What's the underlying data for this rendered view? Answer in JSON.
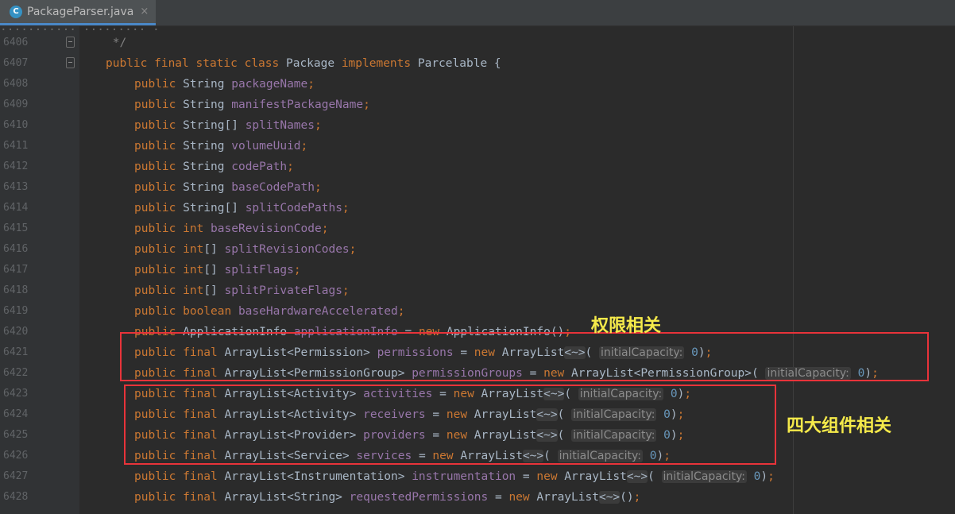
{
  "tab": {
    "icon_letter": "C",
    "filename": "PackageParser.java",
    "close": "×"
  },
  "top_fragment": "    ...........              .........                .",
  "lines": [
    {
      "num": "6406",
      "comment": " */"
    },
    {
      "num": "6407",
      "kw": "public final static class",
      "type": " Package ",
      "kw2": "implements",
      "type2": " Parcelable {"
    },
    {
      "num": "6408",
      "kw": "public",
      "type": " String ",
      "field": "packageName",
      "punct": ";"
    },
    {
      "num": "6409",
      "kw": "public",
      "type": " String ",
      "field": "manifestPackageName",
      "punct": ";"
    },
    {
      "num": "6410",
      "kw": "public",
      "type": " String[] ",
      "field": "splitNames",
      "punct": ";"
    },
    {
      "num": "6411",
      "kw": "public",
      "type": " String ",
      "field": "volumeUuid",
      "punct": ";"
    },
    {
      "num": "6412",
      "kw": "public",
      "type": " String ",
      "field": "codePath",
      "punct": ";"
    },
    {
      "num": "6413",
      "kw": "public",
      "type": " String ",
      "field": "baseCodePath",
      "punct": ";"
    },
    {
      "num": "6414",
      "kw": "public",
      "type": " String[] ",
      "field": "splitCodePaths",
      "punct": ";"
    },
    {
      "num": "6415",
      "kw": "public int",
      "type": " ",
      "field": "baseRevisionCode",
      "punct": ";"
    },
    {
      "num": "6416",
      "kw": "public int",
      "type": "[] ",
      "field": "splitRevisionCodes",
      "punct": ";"
    },
    {
      "num": "6417",
      "kw": "public int",
      "type": "[] ",
      "field": "splitFlags",
      "punct": ";"
    },
    {
      "num": "6418",
      "kw": "public int",
      "type": "[] ",
      "field": "splitPrivateFlags",
      "punct": ";"
    },
    {
      "num": "6419",
      "kw": "public boolean",
      "type": " ",
      "field": "baseHardwareAccelerated",
      "punct": ";"
    },
    {
      "num": "6420",
      "kw": "public",
      "type": " ApplicationInfo ",
      "field": "applicationInfo",
      "eq": " = ",
      "kw2": "new",
      "rest": " ApplicationInfo()",
      "punct": ";"
    },
    {
      "num": "6421",
      "kw": "public final",
      "type": " ArrayList<Permission> ",
      "field": "permissions",
      "eq": " = ",
      "kw2": "new",
      "rest": " ArrayList",
      "diamond": "<~>",
      "open": "( ",
      "hint": "initialCapacity:",
      "num_val": " 0",
      "close": ")",
      "punct": ";"
    },
    {
      "num": "6422",
      "kw": "public final",
      "type": " ArrayList<PermissionGroup> ",
      "field": "permissionGroups",
      "eq": " = ",
      "kw2": "new",
      "rest": " ArrayList<PermissionGroup>",
      "open": "( ",
      "hint": "initialCapacity:",
      "num_val": " 0",
      "close": ")",
      "punct": ";"
    },
    {
      "num": "6423",
      "kw": "public final",
      "type": " ArrayList<Activity> ",
      "field": "activities",
      "eq": " = ",
      "kw2": "new",
      "rest": " ArrayList",
      "diamond": "<~>",
      "open": "( ",
      "hint": "initialCapacity:",
      "num_val": " 0",
      "close": ")",
      "punct": ";"
    },
    {
      "num": "6424",
      "kw": "public final",
      "type": " ArrayList<Activity> ",
      "field": "receivers",
      "eq": " = ",
      "kw2": "new",
      "rest": " ArrayList",
      "diamond": "<~>",
      "open": "( ",
      "hint": "initialCapacity:",
      "num_val": " 0",
      "close": ")",
      "punct": ";"
    },
    {
      "num": "6425",
      "kw": "public final",
      "type": " ArrayList<Provider> ",
      "field": "providers",
      "eq": " = ",
      "kw2": "new",
      "rest": " ArrayList",
      "diamond": "<~>",
      "open": "( ",
      "hint": "initialCapacity:",
      "num_val": " 0",
      "close": ")",
      "punct": ";"
    },
    {
      "num": "6426",
      "kw": "public final",
      "type": " ArrayList<Service> ",
      "field": "services",
      "eq": " = ",
      "kw2": "new",
      "rest": " ArrayList",
      "diamond": "<~>",
      "open": "( ",
      "hint": "initialCapacity:",
      "num_val": " 0",
      "close": ")",
      "punct": ";"
    },
    {
      "num": "6427",
      "kw": "public final",
      "type": " ArrayList<Instrumentation> ",
      "field": "instrumentation",
      "eq": " = ",
      "kw2": "new",
      "rest": " ArrayList",
      "diamond": "<~>",
      "open": "( ",
      "hint": "initialCapacity:",
      "num_val": " 0",
      "close": ")",
      "punct": ";"
    },
    {
      "num": "6428",
      "kw": "public final",
      "type": " ArrayList<String> ",
      "field": "requestedPermissions",
      "eq": " = ",
      "kw2": "new",
      "rest": " ArrayList",
      "diamond": "<~>",
      "open": "()",
      "punct": ";"
    }
  ],
  "annotations": {
    "permissions": "权限相关",
    "components": "四大组件相关"
  },
  "colors": {
    "annotation": "#f5ea4a",
    "box": "#e8333a"
  }
}
